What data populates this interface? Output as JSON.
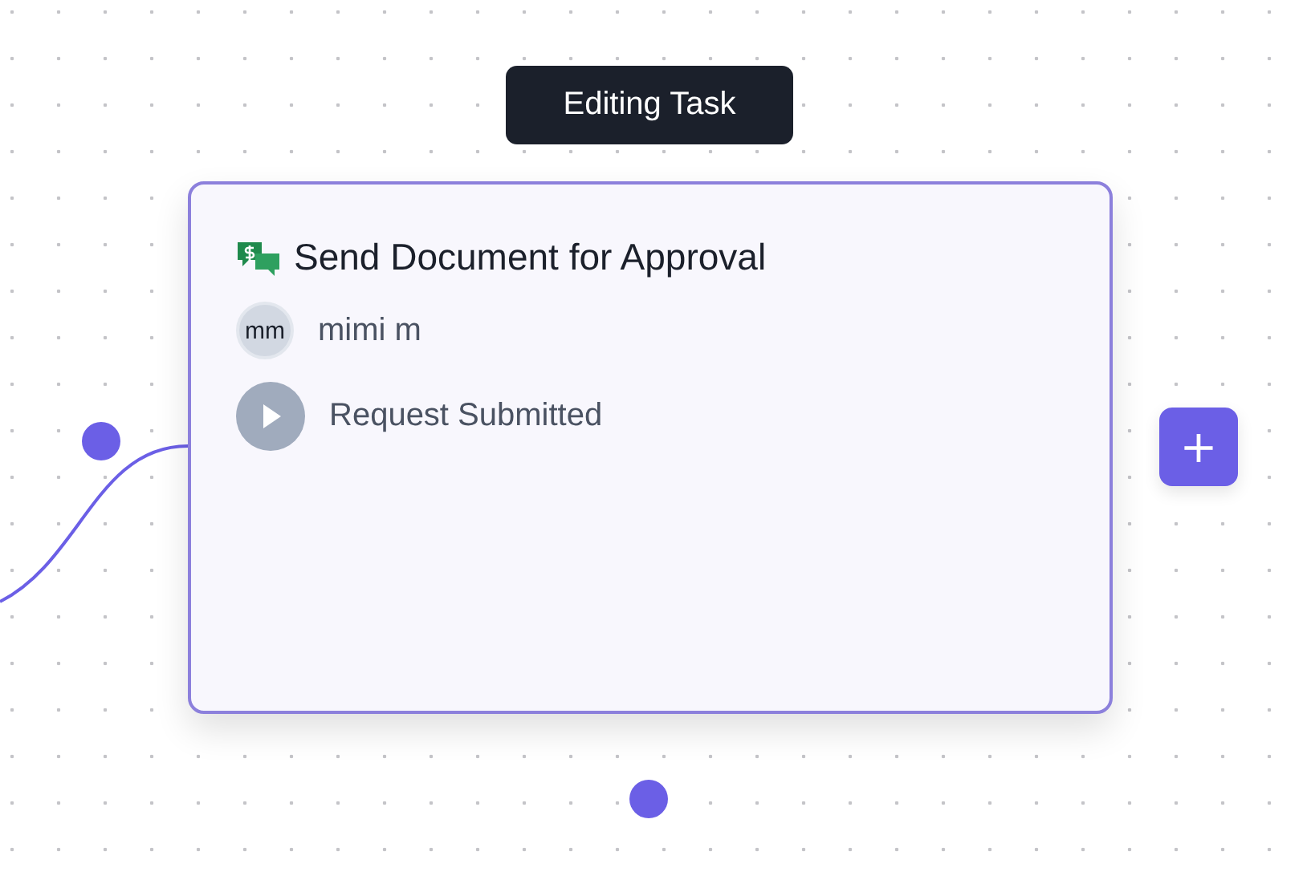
{
  "tooltip": {
    "text": "Editing Task"
  },
  "task_card": {
    "title": "Send Document for Approval",
    "assignee": {
      "initials": "mm",
      "name": "mimi m"
    },
    "status": "Request Submitted"
  },
  "add_button": {
    "label": "+"
  }
}
